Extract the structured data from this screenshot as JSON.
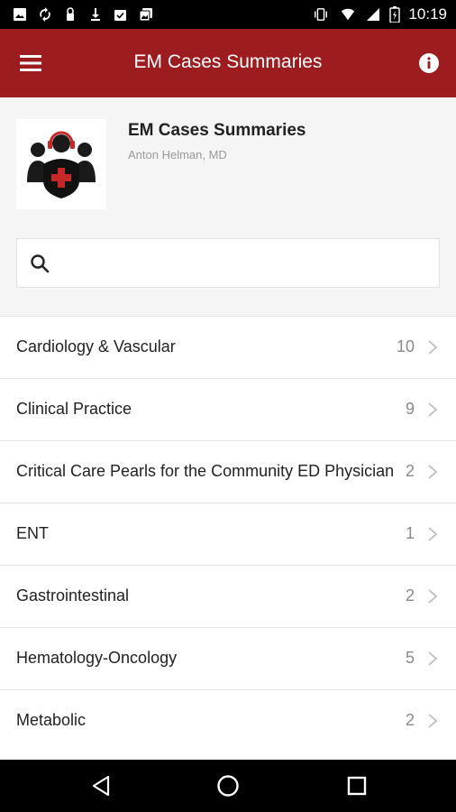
{
  "status_bar": {
    "time": "10:19",
    "left_icons": [
      "image-icon",
      "sync-icon",
      "lock-icon",
      "download-icon",
      "photo-check-icon",
      "photo-stack-icon"
    ],
    "right_icons": [
      "vibrate-icon",
      "wifi-icon",
      "signal-icon",
      "battery-icon"
    ]
  },
  "app_bar": {
    "title": "EM Cases Summaries",
    "color": "#9c1c1f",
    "menu_icon": "menu-icon",
    "info_icon": "info-icon"
  },
  "header": {
    "title": "EM Cases Summaries",
    "author": "Anton Helman, MD",
    "logo": "em-cases-logo"
  },
  "search": {
    "placeholder": "",
    "value": "",
    "icon": "search-icon"
  },
  "categories": [
    {
      "label": "Cardiology & Vascular",
      "count": "10"
    },
    {
      "label": "Clinical Practice",
      "count": "9"
    },
    {
      "label": "Critical Care Pearls for the Community ED Physician",
      "count": "2"
    },
    {
      "label": "ENT",
      "count": "1"
    },
    {
      "label": "Gastrointestinal",
      "count": "2"
    },
    {
      "label": "Hematology-Oncology",
      "count": "5"
    },
    {
      "label": "Metabolic",
      "count": "2"
    }
  ],
  "nav_bar": {
    "icons": [
      "back-icon",
      "home-icon",
      "recents-icon"
    ]
  }
}
